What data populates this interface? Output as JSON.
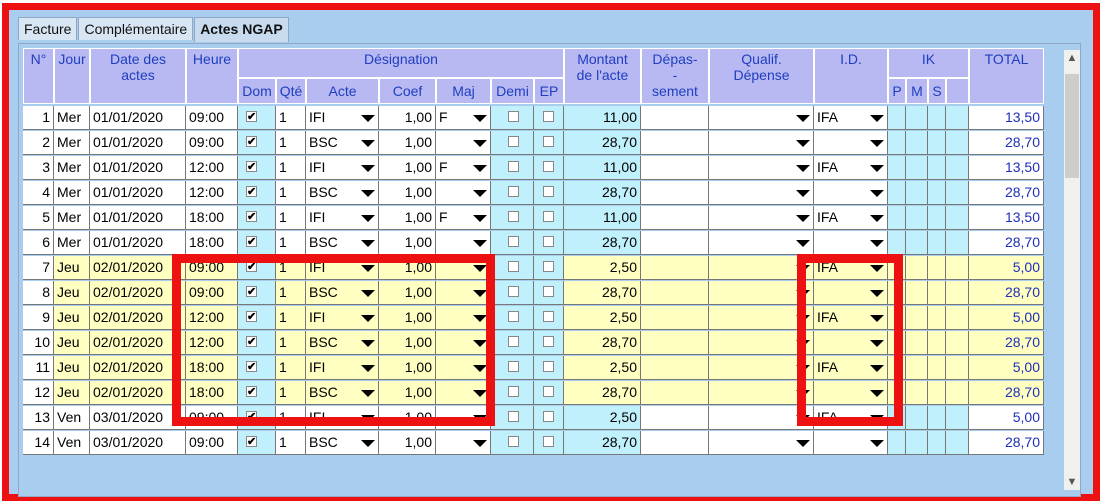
{
  "tabs": [
    {
      "label": "Facture"
    },
    {
      "label": "Complémentaire"
    },
    {
      "label": "Actes NGAP",
      "active": true
    }
  ],
  "headers": {
    "num": "N°",
    "jour": "Jour",
    "date": "Date des actes",
    "heure": "Heure",
    "designation": "Désignation",
    "dom": "Dom",
    "qte": "Qté",
    "acte": "Acte",
    "coef": "Coef",
    "maj": "Maj",
    "demi": "Demi",
    "ep": "EP",
    "montant": "Montant de l'acte",
    "depassement": "Dépas- -sement",
    "qualif": "Qualif. Dépense",
    "id": "I.D.",
    "ik": "IK",
    "ik_p": "P",
    "ik_m": "M",
    "ik_s": "S",
    "total": "TOTAL"
  },
  "rows": [
    {
      "n": "1",
      "jour": "Mer",
      "date": "01/01/2020",
      "heure": "09:00",
      "dom": true,
      "qte": "1",
      "acte": "IFI",
      "coef": "1,00",
      "maj": "F",
      "montant": "11,00",
      "id": "IFA",
      "total": "13,50",
      "bg": "white"
    },
    {
      "n": "2",
      "jour": "Mer",
      "date": "01/01/2020",
      "heure": "09:00",
      "dom": true,
      "qte": "1",
      "acte": "BSC",
      "coef": "1,00",
      "maj": "",
      "montant": "28,70",
      "id": "",
      "total": "28,70",
      "bg": "white"
    },
    {
      "n": "3",
      "jour": "Mer",
      "date": "01/01/2020",
      "heure": "12:00",
      "dom": true,
      "qte": "1",
      "acte": "IFI",
      "coef": "1,00",
      "maj": "F",
      "montant": "11,00",
      "id": "IFA",
      "total": "13,50",
      "bg": "white"
    },
    {
      "n": "4",
      "jour": "Mer",
      "date": "01/01/2020",
      "heure": "12:00",
      "dom": true,
      "qte": "1",
      "acte": "BSC",
      "coef": "1,00",
      "maj": "",
      "montant": "28,70",
      "id": "",
      "total": "28,70",
      "bg": "white"
    },
    {
      "n": "5",
      "jour": "Mer",
      "date": "01/01/2020",
      "heure": "18:00",
      "dom": true,
      "qte": "1",
      "acte": "IFI",
      "coef": "1,00",
      "maj": "F",
      "montant": "11,00",
      "id": "IFA",
      "total": "13,50",
      "bg": "white"
    },
    {
      "n": "6",
      "jour": "Mer",
      "date": "01/01/2020",
      "heure": "18:00",
      "dom": true,
      "qte": "1",
      "acte": "BSC",
      "coef": "1,00",
      "maj": "",
      "montant": "28,70",
      "id": "",
      "total": "28,70",
      "bg": "white"
    },
    {
      "n": "7",
      "jour": "Jeu",
      "date": "02/01/2020",
      "heure": "09:00",
      "dom": true,
      "qte": "1",
      "acte": "IFI",
      "coef": "1,00",
      "maj": "",
      "montant": "2,50",
      "id": "IFA",
      "total": "5,00",
      "bg": "yellow"
    },
    {
      "n": "8",
      "jour": "Jeu",
      "date": "02/01/2020",
      "heure": "09:00",
      "dom": true,
      "qte": "1",
      "acte": "BSC",
      "coef": "1,00",
      "maj": "",
      "montant": "28,70",
      "id": "",
      "total": "28,70",
      "bg": "yellow"
    },
    {
      "n": "9",
      "jour": "Jeu",
      "date": "02/01/2020",
      "heure": "12:00",
      "dom": true,
      "qte": "1",
      "acte": "IFI",
      "coef": "1,00",
      "maj": "",
      "montant": "2,50",
      "id": "IFA",
      "total": "5,00",
      "bg": "yellow"
    },
    {
      "n": "10",
      "jour": "Jeu",
      "date": "02/01/2020",
      "heure": "12:00",
      "dom": true,
      "qte": "1",
      "acte": "BSC",
      "coef": "1,00",
      "maj": "",
      "montant": "28,70",
      "id": "",
      "total": "28,70",
      "bg": "yellow"
    },
    {
      "n": "11",
      "jour": "Jeu",
      "date": "02/01/2020",
      "heure": "18:00",
      "dom": true,
      "qte": "1",
      "acte": "IFI",
      "coef": "1,00",
      "maj": "",
      "montant": "2,50",
      "id": "IFA",
      "total": "5,00",
      "bg": "yellow"
    },
    {
      "n": "12",
      "jour": "Jeu",
      "date": "02/01/2020",
      "heure": "18:00",
      "dom": true,
      "qte": "1",
      "acte": "BSC",
      "coef": "1,00",
      "maj": "",
      "montant": "28,70",
      "id": "",
      "total": "28,70",
      "bg": "yellow"
    },
    {
      "n": "13",
      "jour": "Ven",
      "date": "03/01/2020",
      "heure": "09:00",
      "dom": true,
      "qte": "1",
      "acte": "IFI",
      "coef": "1,00",
      "maj": "",
      "montant": "2,50",
      "id": "IFA",
      "total": "5,00",
      "bg": "white"
    },
    {
      "n": "14",
      "jour": "Ven",
      "date": "03/01/2020",
      "heure": "09:00",
      "dom": true,
      "qte": "1",
      "acte": "BSC",
      "coef": "1,00",
      "maj": "",
      "montant": "28,70",
      "id": "",
      "total": "28,70",
      "bg": "white"
    }
  ],
  "colors": {
    "highlight": "#ee1111",
    "header_bg": "#b8b8f2",
    "header_text": "#1f3fc0",
    "cyan_cell": "#bff0fb",
    "yellow_row": "#ffffc2"
  },
  "icons": {
    "dropdown": "chevron-down-icon",
    "scroll_up": "scroll-up-icon",
    "scroll_down": "scroll-down-icon"
  }
}
